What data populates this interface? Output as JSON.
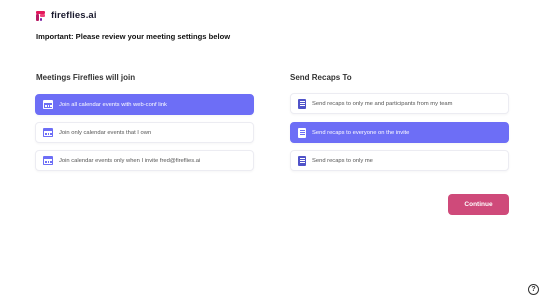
{
  "brand": {
    "name": "fireflies.ai"
  },
  "notice": "Important: Please review your meeting settings below",
  "meetings": {
    "title": "Meetings Fireflies will join",
    "options": [
      {
        "label": "Join all calendar events with web-conf link",
        "icon": "calendar-icon",
        "selected": true
      },
      {
        "label": "Join only calendar events that I own",
        "icon": "calendar-icon",
        "selected": false
      },
      {
        "label": "Join calendar events only when I invite fred@fireflies.ai",
        "icon": "calendar-icon",
        "selected": false
      }
    ]
  },
  "recaps": {
    "title": "Send Recaps To",
    "options": [
      {
        "label": "Send recaps to only me and participants from my team",
        "icon": "document-icon",
        "selected": false
      },
      {
        "label": "Send recaps to everyone on the invite",
        "icon": "document-icon",
        "selected": true
      },
      {
        "label": "Send recaps to only me",
        "icon": "document-icon",
        "selected": false
      }
    ]
  },
  "continue_label": "Continue",
  "help_label": "?",
  "colors": {
    "accent": "#6d6ef6",
    "continue": "#cf4a7a",
    "brand": "#e2185b"
  }
}
